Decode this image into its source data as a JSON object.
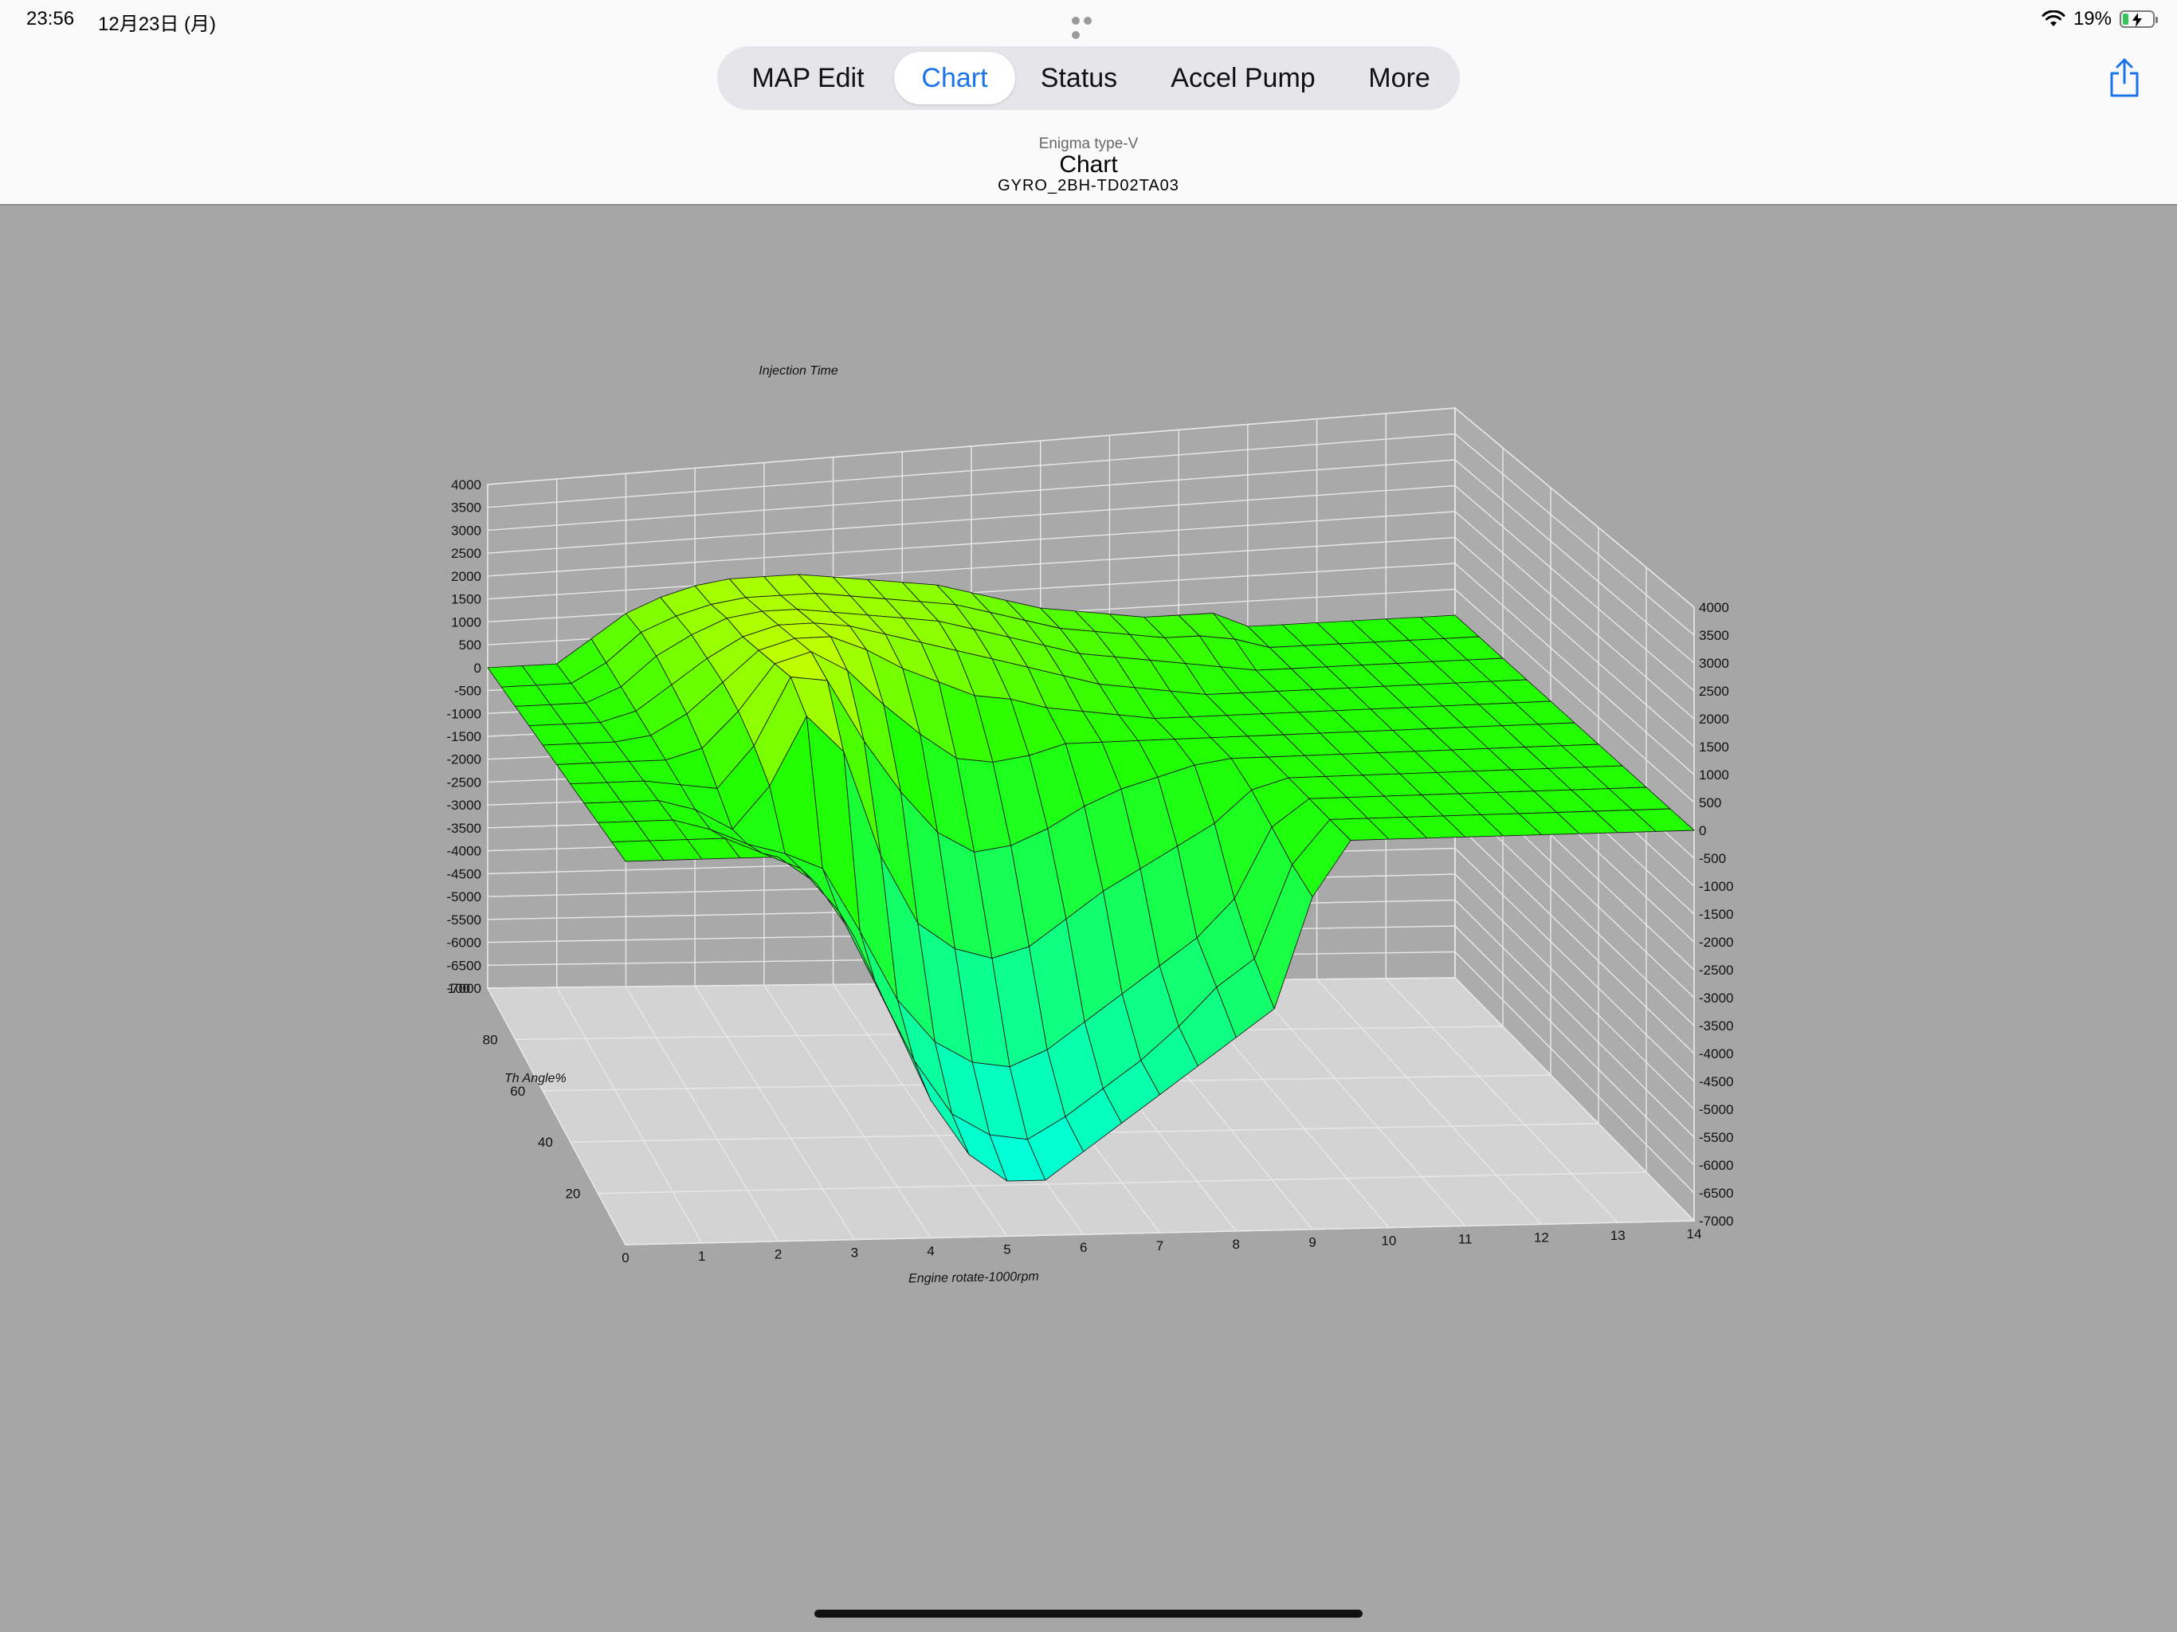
{
  "status_bar": {
    "time": "23:56",
    "date": "12月23日 (月)",
    "battery_percent": "19%",
    "battery_level": 0.19,
    "icons": [
      "wifi-icon",
      "battery-charging-icon"
    ]
  },
  "segmented_control": {
    "selected": "Chart",
    "items": [
      {
        "label": "MAP Edit"
      },
      {
        "label": "Chart"
      },
      {
        "label": "Status"
      },
      {
        "label": "Accel Pump"
      },
      {
        "label": "More"
      }
    ]
  },
  "nav": {
    "subtitle_top": "Enigma type-V",
    "title": "Chart",
    "subtitle_bottom": "GYRO_2BH-TD02TA03",
    "share_icon": "share-icon"
  },
  "colors": {
    "background": "#a6a6a6",
    "accent": "#1a73e8",
    "surface_high": "#22ff00",
    "surface_peak": "#c8ff00",
    "surface_low": "#00ffdd"
  },
  "chart_data": {
    "type": "surface3d",
    "title": "Injection Time",
    "xlabel": "Engine rotate-1000rpm",
    "ylabel": "Th Angle%",
    "zlabel": "",
    "xlim": [
      0,
      14
    ],
    "ylim": [
      0,
      100
    ],
    "zlim": [
      -7000,
      4000
    ],
    "x_ticks": [
      "0",
      "1",
      "2",
      "3",
      "4",
      "5",
      "6",
      "7",
      "8",
      "9",
      "10",
      "11",
      "12",
      "13",
      "14"
    ],
    "y_ticks": [
      "20",
      "40",
      "60",
      "80",
      "100"
    ],
    "z_ticks_left": [
      "4000",
      "3500",
      "3000",
      "2500",
      "2000",
      "1500",
      "1000",
      "500",
      "0",
      "-500",
      "-1000",
      "-1500",
      "-2000",
      "-2500",
      "-3000",
      "-3500",
      "-4000",
      "-4500",
      "-5000",
      "-5500",
      "-6000",
      "-6500",
      "-7000"
    ],
    "z_ticks_right": [
      "4000",
      "3500",
      "3000",
      "2500",
      "2000",
      "1500",
      "1000",
      "500",
      "0",
      "-500",
      "-1000",
      "-1500",
      "-2000",
      "-2500",
      "-3000",
      "-3500",
      "-4000",
      "-4500",
      "-5000",
      "-5500",
      "-6000",
      "-6500",
      "-7000"
    ],
    "grid": true,
    "surface": {
      "note_values": "approximate injection-time values read off the rendered surface",
      "x": [
        0,
        0.5,
        1,
        1.5,
        2,
        2.5,
        3,
        3.5,
        4,
        4.5,
        5,
        5.5,
        6,
        6.5,
        7,
        7.5,
        8,
        8.5,
        9,
        9.5,
        10,
        10.5,
        11,
        11.5,
        12,
        12.5,
        13,
        13.5,
        14
      ],
      "y": [
        0,
        10,
        20,
        30,
        40,
        50,
        60,
        70,
        80,
        90,
        100
      ],
      "z": [
        [
          0,
          0,
          0,
          0,
          0,
          -500,
          -1500,
          -3000,
          -4500,
          -5500,
          -6000,
          -6000,
          -5500,
          -5000,
          -4500,
          -4000,
          -3500,
          -3000,
          -1000,
          0,
          0,
          0,
          0,
          0,
          0,
          0,
          0,
          0,
          0
        ],
        [
          0,
          0,
          0,
          0,
          -300,
          -600,
          -1400,
          -2800,
          -4200,
          -5200,
          -5600,
          -5700,
          -5300,
          -4800,
          -4300,
          -3700,
          -3000,
          -2500,
          -800,
          0,
          0,
          0,
          0,
          0,
          0,
          0,
          0,
          0,
          0
        ],
        [
          0,
          0,
          0,
          -200,
          -500,
          -700,
          -1000,
          -2200,
          -3500,
          -4300,
          -4700,
          -4800,
          -4500,
          -4000,
          -3500,
          -3000,
          -2500,
          -1800,
          -500,
          0,
          0,
          0,
          0,
          0,
          0,
          0,
          0,
          0,
          0
        ],
        [
          0,
          0,
          0,
          -200,
          -600,
          200,
          1500,
          800,
          -1200,
          -2500,
          -3000,
          -3200,
          -3000,
          -2500,
          -2000,
          -1600,
          -1200,
          -800,
          -200,
          0,
          0,
          0,
          0,
          0,
          0,
          0,
          0,
          0,
          0
        ],
        [
          0,
          0,
          0,
          -100,
          -200,
          600,
          1900,
          1800,
          600,
          -400,
          -1200,
          -1600,
          -1500,
          -1200,
          -800,
          -500,
          -300,
          -100,
          0,
          0,
          0,
          0,
          0,
          0,
          0,
          0,
          0,
          0,
          0
        ],
        [
          0,
          0,
          0,
          0,
          200,
          900,
          1800,
          2000,
          1600,
          900,
          300,
          -200,
          -300,
          -200,
          0,
          0,
          0,
          0,
          0,
          0,
          0,
          0,
          0,
          0,
          0,
          0,
          0,
          0,
          0
        ],
        [
          0,
          0,
          0,
          100,
          500,
          1100,
          1700,
          1900,
          1900,
          1600,
          1200,
          900,
          600,
          500,
          300,
          200,
          100,
          0,
          0,
          0,
          0,
          0,
          0,
          0,
          0,
          0,
          0,
          0,
          0
        ],
        [
          0,
          0,
          0,
          200,
          700,
          1200,
          1600,
          1800,
          1800,
          1700,
          1500,
          1300,
          1100,
          900,
          700,
          500,
          300,
          200,
          100,
          0,
          0,
          0,
          0,
          0,
          0,
          0,
          0,
          0,
          0
        ],
        [
          0,
          0,
          0,
          300,
          900,
          1300,
          1600,
          1700,
          1700,
          1600,
          1500,
          1400,
          1300,
          1100,
          900,
          700,
          500,
          400,
          300,
          200,
          100,
          0,
          0,
          0,
          0,
          0,
          0,
          0,
          0
        ],
        [
          0,
          0,
          0,
          400,
          1000,
          1300,
          1500,
          1600,
          1600,
          1600,
          1500,
          1400,
          1300,
          1200,
          1000,
          800,
          600,
          500,
          400,
          300,
          300,
          200,
          0,
          0,
          0,
          0,
          0,
          0,
          0
        ],
        [
          0,
          0,
          0,
          500,
          1000,
          1300,
          1500,
          1600,
          1600,
          1600,
          1500,
          1400,
          1300,
          1200,
          1000,
          800,
          600,
          500,
          400,
          300,
          300,
          300,
          0,
          0,
          0,
          0,
          0,
          0,
          0
        ]
      ]
    }
  }
}
